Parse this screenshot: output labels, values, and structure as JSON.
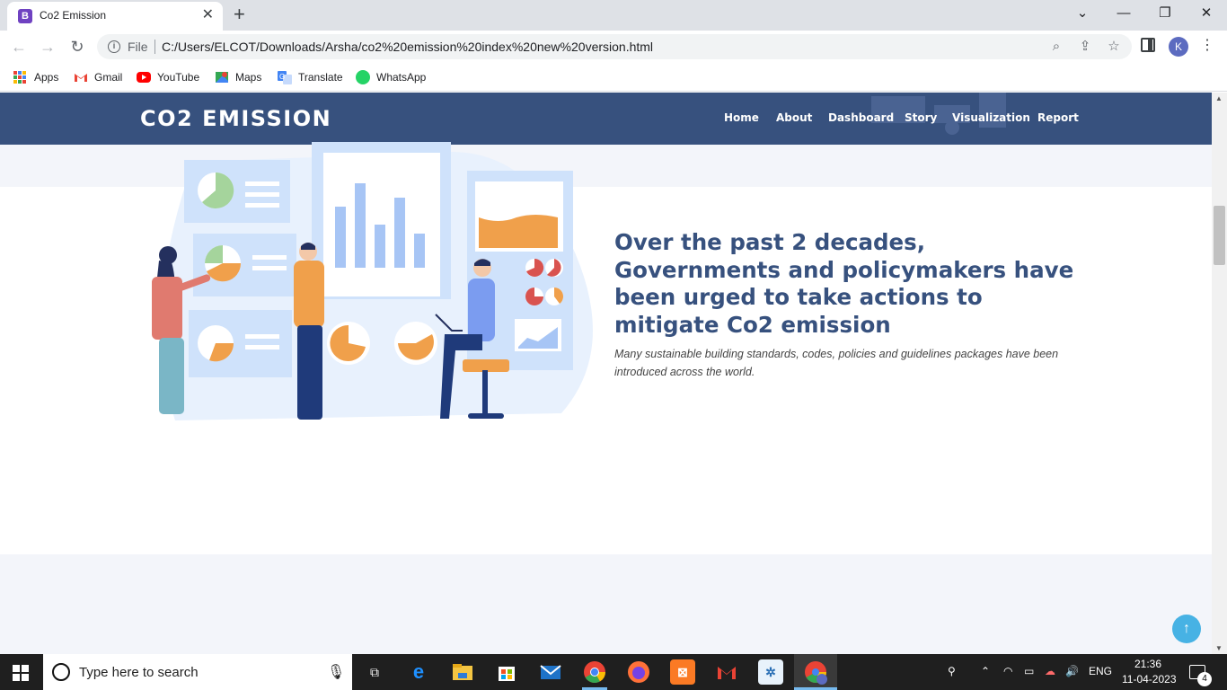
{
  "browser": {
    "tab_title": "Co2 Emission",
    "tab_favicon": "B",
    "tab_close": "✕",
    "new_tab": "+",
    "file_label": "File",
    "url": "C:/Users/ELCOT/Downloads/Arsha/co2%20emission%20index%20new%20version.html",
    "profile_initial": "K"
  },
  "bookmarks": [
    {
      "label": "Apps",
      "icon": "apps-grid-icon"
    },
    {
      "label": "Gmail",
      "icon": "gmail-icon",
      "color": "#ea4335"
    },
    {
      "label": "YouTube",
      "icon": "youtube-icon",
      "color": "#ff0000"
    },
    {
      "label": "Maps",
      "icon": "maps-icon",
      "color": "#34a853"
    },
    {
      "label": "Translate",
      "icon": "translate-icon",
      "color": "#4285f4"
    },
    {
      "label": "WhatsApp",
      "icon": "whatsapp-icon",
      "color": "#25d366"
    }
  ],
  "site": {
    "logo": "CO2 EMISSION",
    "nav": [
      "Home",
      "About",
      "Dashboard",
      "Story",
      "Visualization",
      "Report"
    ],
    "headline": "Over the past 2 decades, Governments and policymakers have been urged to take actions to mitigate Co2 emission",
    "subtext": "Many sustainable building standards, codes, policies and guidelines packages have been introduced across the world.",
    "scroll_top": "↑",
    "colors": {
      "header": "#37517e",
      "accent": "#47b2e4",
      "section_bg": "#f3f5fa"
    }
  },
  "taskbar": {
    "search_placeholder": "Type here to search",
    "apps": [
      "task-view-icon",
      "edge-icon",
      "file-explorer-icon",
      "store-icon",
      "mail-icon",
      "chrome-icon",
      "firefox-icon",
      "xampp-icon",
      "gmail-icon",
      "snipping-icon",
      "chrome-profile-icon"
    ],
    "language": "ENG",
    "time": "21:36",
    "date": "11-04-2023",
    "notification_count": "4"
  }
}
